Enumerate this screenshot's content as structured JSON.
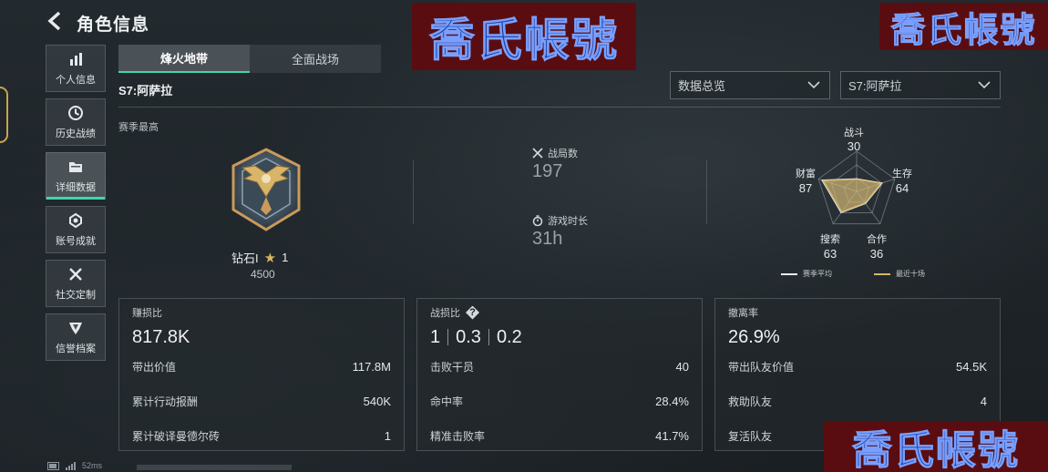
{
  "header": {
    "title": "角色信息"
  },
  "sidebar": {
    "items": [
      {
        "label": "个人信息",
        "icon": "bar-chart-icon",
        "active": false
      },
      {
        "label": "历史战绩",
        "icon": "history-icon",
        "active": false
      },
      {
        "label": "详细数据",
        "icon": "folder-icon",
        "active": true
      },
      {
        "label": "账号成就",
        "icon": "medal-icon",
        "active": false
      },
      {
        "label": "社交定制",
        "icon": "tools-icon",
        "active": false
      },
      {
        "label": "信誉档案",
        "icon": "shield-badge-icon",
        "active": false
      }
    ]
  },
  "tabs": [
    {
      "label": "烽火地带",
      "active": true
    },
    {
      "label": "全面战场",
      "active": false
    }
  ],
  "season": {
    "name": "S7:阿萨拉",
    "best_label": "赛季最高"
  },
  "filters": {
    "view": {
      "value": "数据总览"
    },
    "season": {
      "value": "S7:阿萨拉"
    }
  },
  "rank": {
    "name": "钻石I",
    "stars": "1",
    "points": "4500"
  },
  "summary": {
    "matches": {
      "label": "战局数",
      "value": "197"
    },
    "playtime": {
      "label": "游戏时长",
      "value": "31h"
    }
  },
  "radar": {
    "axes": [
      {
        "label": "战斗",
        "value": "30"
      },
      {
        "label": "生存",
        "value": "64"
      },
      {
        "label": "合作",
        "value": "36"
      },
      {
        "label": "搜索",
        "value": "63"
      },
      {
        "label": "财富",
        "value": "87"
      }
    ],
    "legend": [
      {
        "label": "赛季平均",
        "color": "#e8ecee"
      },
      {
        "label": "最近十场",
        "color": "#d8b761"
      }
    ]
  },
  "cards": {
    "profit": {
      "title": "赚损比",
      "value": "817.8K",
      "rows": [
        {
          "label": "带出价值",
          "value": "117.8M"
        },
        {
          "label": "累计行动报酬",
          "value": "540K"
        },
        {
          "label": "累计破译曼德尔砖",
          "value": "1"
        }
      ]
    },
    "combat": {
      "title": "战损比",
      "values": [
        "1",
        "0.3",
        "0.2"
      ],
      "rows": [
        {
          "label": "击败干员",
          "value": "40"
        },
        {
          "label": "命中率",
          "value": "28.4%"
        },
        {
          "label": "精准击败率",
          "value": "41.7%"
        }
      ]
    },
    "extract": {
      "title": "撤离率",
      "value": "26.9%",
      "rows": [
        {
          "label": "带出队友价值",
          "value": "54.5K"
        },
        {
          "label": "救助队友",
          "value": "4"
        },
        {
          "label": "复活队友",
          "value": ""
        }
      ]
    }
  },
  "watermark": {
    "text": "喬氏帳號"
  },
  "status": {
    "ping": "52ms"
  },
  "colors": {
    "accent": "#3ed8a8",
    "gold": "#d8b761"
  }
}
